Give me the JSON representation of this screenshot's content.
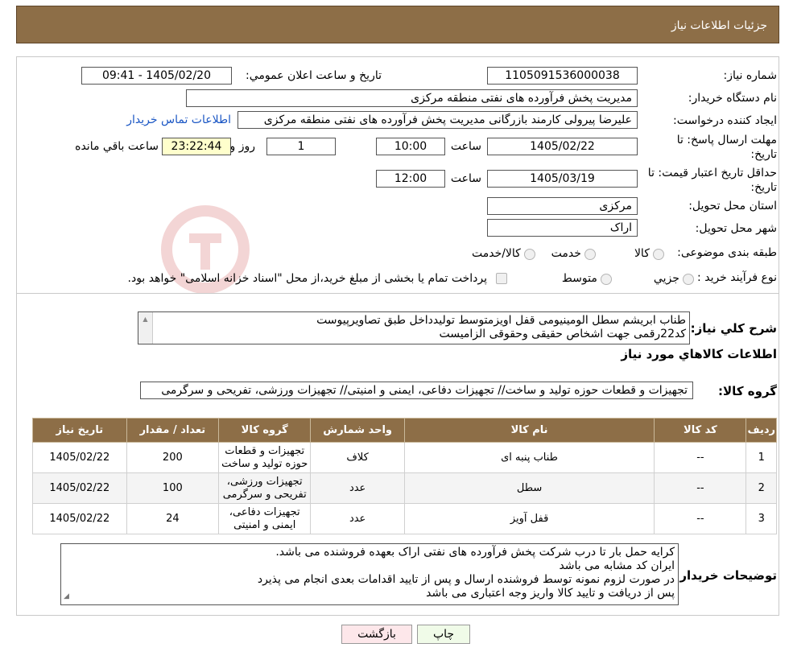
{
  "header": {
    "title": "جزئیات اطلاعات نیاز"
  },
  "form": {
    "need_number_label": "شماره نیاز:",
    "need_number_value": "1105091536000038",
    "announce_label": "تاريخ و ساعت اعلان عمومي:",
    "announce_value": "1405/02/20 - 09:41",
    "buyer_org_label": "نام دستگاه خريدار:",
    "buyer_org_value": "مديريت پخش فرآورده هاى نفتى منطقه مركزى",
    "requester_label": "ايجاد كننده درخواست:",
    "requester_value": "عليرضا پيرولى كارمند بازرگانى مديريت پخش فرآورده هاى نفتى منطقه مركزى",
    "contact_link": "اطلاعات تماس خريدار",
    "deadline_label": "مهلت ارسال پاسخ: تا تاريخ:",
    "deadline_date": "1405/02/22",
    "time_label": "ساعت",
    "deadline_time": "10:00",
    "days_value": "1",
    "days_label": "روز و",
    "remaining_time": "23:22:44",
    "remaining_label": "ساعت باقي مانده",
    "validity_label": "حداقل تاريخ اعتبار قيمت: تا تاريخ:",
    "validity_date": "1405/03/19",
    "validity_time": "12:00",
    "province_label": "استان محل تحويل:",
    "province_value": "مركزى",
    "city_label": "شهر محل تحويل:",
    "city_value": "اراک",
    "category_label": "طبقه بندى موضوعى:",
    "category_options": [
      "كالا",
      "خدمت",
      "كالا/خدمت"
    ],
    "process_label": "نوع فرآيند خريد :",
    "process_options": [
      "جزيي",
      "متوسط"
    ],
    "process_note": "پرداخت تمام يا بخشى از مبلغ خريد،از محل \"اسناد خزانه اسلامى\" خواهد بود."
  },
  "description": {
    "label": "شرح كلي نياز:",
    "line1": "طناب ابريشم سطل الومينيومى قفل اويزمتوسط توليدداخل طبق تصاويرپيوست",
    "line2": "كد22رقمى  جهت اشخاص حقيقى وحقوقى الزاميست"
  },
  "goods_info_title": "اطلاعات كالاهاي مورد نياز",
  "goods_group": {
    "label": "گروه كالا:",
    "value": "تجهيزات و قطعات حوزه توليد و ساخت// تجهيزات دفاعى، ايمنى و امنيتى// تجهيزات ورزشى، تفريحى و سرگرمى"
  },
  "table": {
    "headers": [
      "رديف",
      "كد كالا",
      "نام كالا",
      "واحد شمارش",
      "گروه كالا",
      "تعداد / مقدار",
      "تاريخ نياز"
    ],
    "rows": [
      [
        "1",
        "--",
        "طناب پنبه اى",
        "كلاف",
        "تجهيزات و قطعات حوزه توليد و ساخت",
        "200",
        "1405/02/22"
      ],
      [
        "2",
        "--",
        "سطل",
        "عدد",
        "تجهيزات ورزشى، تفريحى و سرگرمى",
        "100",
        "1405/02/22"
      ],
      [
        "3",
        "--",
        "قفل آويز",
        "عدد",
        "تجهيزات دفاعى، ايمنى و امنيتى",
        "24",
        "1405/02/22"
      ]
    ]
  },
  "buyer_notes": {
    "label": "توضيحات خريدار:",
    "lines": [
      "كرايه حمل بار تا درب شركت  پخش فرآورده هاى نفتى اراک بعهده فروشنده مى باشد.",
      "ايران كد مشابه مى باشد",
      "در صورت لزوم نمونه توسط فروشنده ارسال و پس از تاييد اقدامات بعدى انجام مى پذيرد",
      "پس از دريافت و تاييد كالا واريز وجه اعتبارى مى باشد"
    ]
  },
  "buttons": {
    "print": "چاپ",
    "back": "بازگشت"
  },
  "colors": {
    "header_bg": "#8d6e47",
    "print_bg": "#f0fbe8",
    "back_bg": "#fde7ea"
  }
}
